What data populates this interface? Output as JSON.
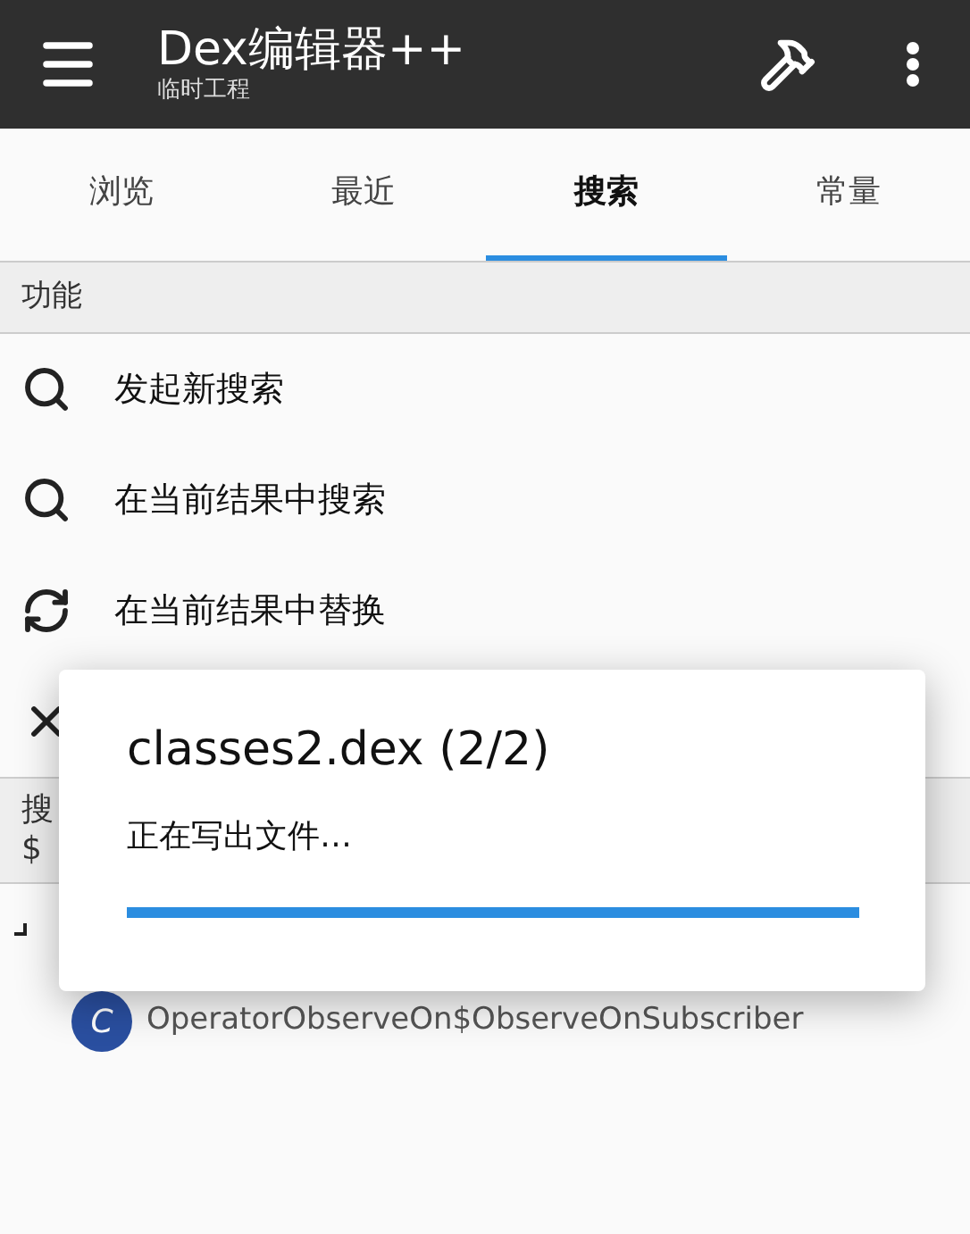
{
  "app_bar": {
    "title": "Dex编辑器++",
    "subtitle": "临时工程"
  },
  "tabs": [
    {
      "label": "浏览",
      "selected": false
    },
    {
      "label": "最近",
      "selected": false
    },
    {
      "label": "搜索",
      "selected": true
    },
    {
      "label": "常量",
      "selected": false
    }
  ],
  "section": {
    "title": "功能"
  },
  "actions": [
    {
      "kind": "search",
      "label": "发起新搜索"
    },
    {
      "kind": "search",
      "label": "在当前结果中搜索"
    },
    {
      "kind": "replace",
      "label": "在当前结果中替换"
    },
    {
      "kind": "clear"
    }
  ],
  "result_header": {
    "line_1": "搜",
    "line_2": "$"
  },
  "results": [
    {
      "badge": "C",
      "name": "OperatorObserveOn$ObserveOnSubscriber"
    }
  ],
  "dialog": {
    "title": "classes2.dex (2/2)",
    "message": "正在写出文件…",
    "level": 1
  }
}
